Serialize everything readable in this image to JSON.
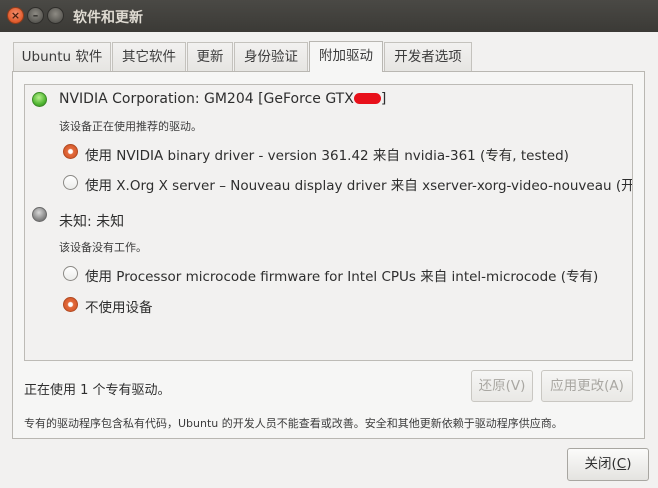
{
  "window": {
    "title": "软件和更新",
    "close_glyph": "×",
    "min_glyph": "–"
  },
  "tabs": [
    {
      "label": "Ubuntu 软件"
    },
    {
      "label": "其它软件"
    },
    {
      "label": "更新"
    },
    {
      "label": "身份验证"
    },
    {
      "label": "附加驱动",
      "active": true
    },
    {
      "label": "开发者选项"
    }
  ],
  "devices": [
    {
      "name_prefix": "NVIDIA Corporation: GM204 [GeForce GTX",
      "name_suffix": "]",
      "status": "该设备正在使用推荐的驱动。",
      "status_color": "#52b733",
      "options": [
        {
          "label": "使用 NVIDIA binary driver - version 361.42 来自 nvidia-361 (专有, tested)",
          "checked": true
        },
        {
          "label": "使用 X.Org X server – Nouveau display driver 来自 xserver-xorg-video-nouveau (开",
          "checked": false
        }
      ]
    },
    {
      "name": "未知: 未知",
      "status": "该设备没有工作。",
      "status_color": "#8a8a8a",
      "options": [
        {
          "label": "使用 Processor microcode firmware for Intel CPUs 来自 intel-microcode (专有)",
          "checked": false
        },
        {
          "label": "不使用设备",
          "checked": true
        }
      ]
    }
  ],
  "footer": {
    "status": "正在使用 1 个专有驱动。",
    "revert_label": "还原(V)",
    "apply_label": "应用更改(A)",
    "note": "专有的驱动程序包含私有代码，Ubuntu 的开发人员不能查看或改善。安全和其他更新依赖于驱动程序供应商。",
    "close_label_prefix": "关闭(",
    "close_mnemonic": "C",
    "close_label_suffix": ")"
  },
  "colors": {
    "accent": "#e26a3c",
    "titlebar": "#3b3a36",
    "redaction": "#e8101a"
  }
}
